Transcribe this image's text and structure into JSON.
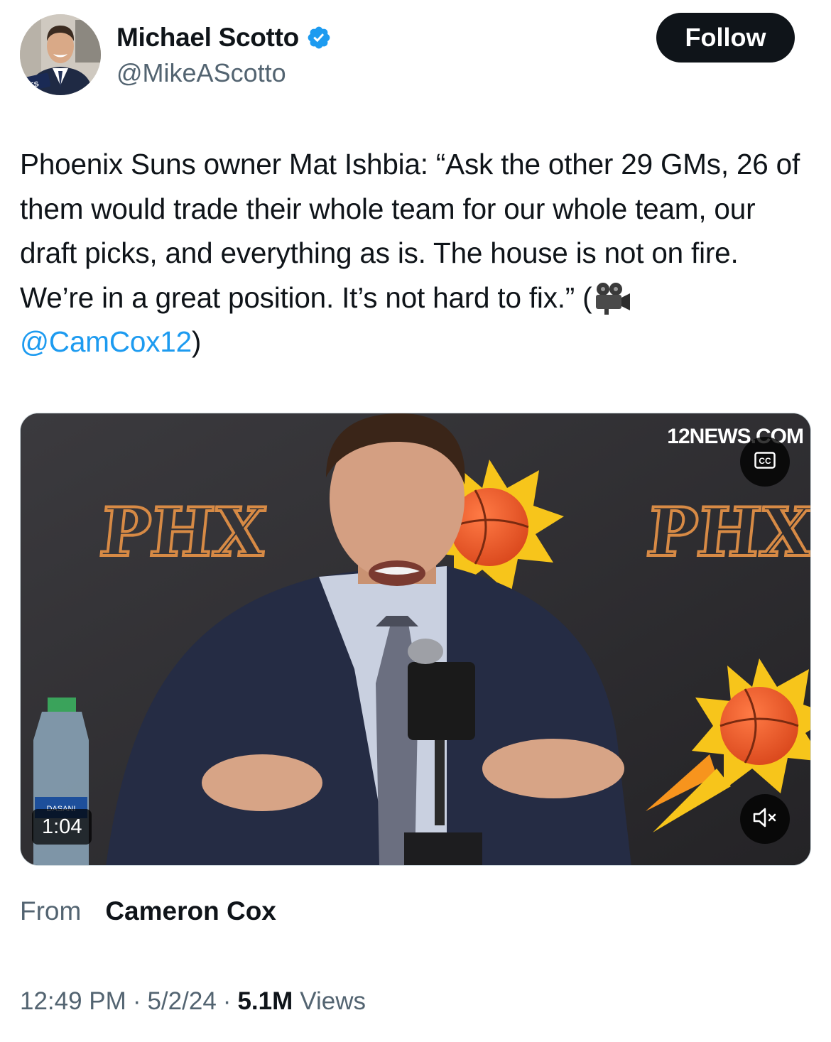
{
  "author": {
    "display_name": "Michael Scotto",
    "handle": "@MikeAScotto",
    "verified_icon": "verified-badge-icon",
    "avatar_mic_flag": "YES"
  },
  "follow_label": "Follow",
  "tweet": {
    "text_before": "Phoenix Suns owner Mat Ishbia: “Ask the other 29 GMs, 26 of them would trade their whole team for our whole team, our draft picks, and everything as is. The house is not on fire. We’re in a great position. It’s not hard to fix.” (",
    "emoji": "movie-camera-icon",
    "mention": "@CamCox12",
    "text_after": ")"
  },
  "video": {
    "watermark": "12NEWS.COM",
    "backdrop_text": "PHX",
    "bottle_label": "DASANI",
    "duration": "1:04",
    "cc_icon": "closed-captions-icon",
    "mute_icon": "muted-speaker-icon"
  },
  "source": {
    "label": "From",
    "name": "Cameron Cox"
  },
  "meta": {
    "time": "12:49 PM",
    "date": "5/2/24",
    "views_count": "5.1M",
    "views_label": "Views",
    "separator": "·"
  },
  "colors": {
    "link": "#1d9bf0",
    "text_primary": "#0f1419",
    "text_secondary": "#536471",
    "button_bg": "#0f1419"
  }
}
